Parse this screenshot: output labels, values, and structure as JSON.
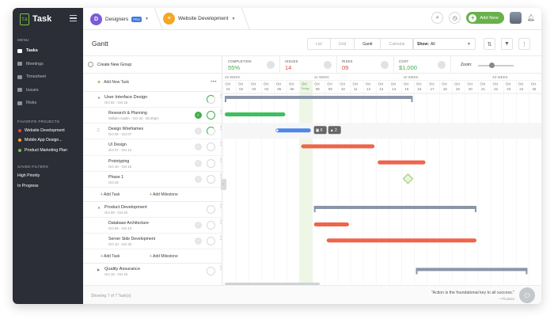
{
  "app": {
    "name": "Task"
  },
  "sidebar": {
    "menu_heading": "MENU",
    "menu": [
      {
        "label": "Tasks",
        "active": true
      },
      {
        "label": "Meetings",
        "active": false
      },
      {
        "label": "Timesheet",
        "active": false
      },
      {
        "label": "Issues",
        "active": false
      },
      {
        "label": "Risks",
        "active": false
      }
    ],
    "favorites_heading": "FAVORITE PROJECTS",
    "favorites": [
      {
        "label": "Website Development",
        "color": "#e8453c"
      },
      {
        "label": "Mobile App Design...",
        "color": "#f5a623"
      },
      {
        "label": "Product Marketing Plan",
        "color": "#7bc043"
      }
    ],
    "filters_heading": "SAVED FILTERS",
    "filters": [
      "High Priority",
      "In Progress"
    ]
  },
  "topbar": {
    "workspace_initial": "D",
    "workspace_name": "Designers",
    "workspace_badge": "PRO",
    "project_name": "Website Development",
    "add_new_label": "Add New"
  },
  "titlebar": {
    "title": "Gantt",
    "views": [
      "List",
      "Grid",
      "Gantt",
      "Calendar"
    ],
    "active_view": "Gantt",
    "show_label": "Show:",
    "show_value": "All"
  },
  "stats": {
    "completion": {
      "label": "COMPLETION",
      "value": "55%",
      "color": "#3fae49"
    },
    "issues": {
      "label": "ISSUES",
      "value": "14",
      "color": "#e8453c"
    },
    "risks": {
      "label": "RISKS",
      "value": "09",
      "color": "#e8453c"
    },
    "cost": {
      "label": "COST",
      "value": "$1,000",
      "color": "#3fae49"
    },
    "zoom_label": "Zoom:",
    "zoom_level": 0.35
  },
  "tasklist": {
    "create_group": "Create New Group",
    "add_new_task": "Add New Task",
    "add_task": "Add Task",
    "add_milestone": "Add Milestone",
    "groups": [
      {
        "name": "User Interface Design",
        "dates": "Oct 02 - Oct 15",
        "tasks": [
          {
            "name": "Research & Planning",
            "dates": "William Austin - Oct 02 - 05:20pm",
            "done": true
          },
          {
            "name": "Design Wireframes",
            "dates": "Oct 05 - Oct 07",
            "done": false
          },
          {
            "name": "UI Design",
            "dates": "Oct 07 - Oct 12",
            "done": false
          },
          {
            "name": "Prototyping",
            "dates": "Oct 10 - Oct 15",
            "done": false
          },
          {
            "name": "Phase 1",
            "dates": "Oct 15",
            "done": false
          }
        ]
      },
      {
        "name": "Product Development",
        "dates": "Oct 09 - Oct 20",
        "tasks": [
          {
            "name": "Database Architecture",
            "dates": "Oct 09 - Oct 10",
            "done": false
          },
          {
            "name": "Server Side Development",
            "dates": "Oct 10 - Oct 20",
            "done": false
          }
        ]
      },
      {
        "name": "Quality Assurance",
        "dates": "Oct 16 - Oct 25",
        "tasks": []
      }
    ]
  },
  "gantt": {
    "weeks": [
      "40 WEEK",
      "41 WEEK",
      "42 WEEK",
      "43 WEEK"
    ],
    "days": [
      "01",
      "02",
      "03",
      "04",
      "05",
      "06",
      "07",
      "08",
      "09",
      "10",
      "11",
      "12",
      "13",
      "14",
      "15",
      "16",
      "17",
      "18",
      "19",
      "20",
      "21",
      "22",
      "23",
      "24",
      "25"
    ],
    "month": "Oct",
    "today_label": "Today",
    "today_day": "07",
    "badge_comments": "6",
    "badge_alerts": "2",
    "bars": [
      {
        "row": 0,
        "start": "01",
        "end": "15",
        "kind": "summary",
        "color": "#8a96a8"
      },
      {
        "row": 1,
        "start": "01",
        "end": "05",
        "kind": "task",
        "color": "#3fbf5f"
      },
      {
        "row": 2,
        "start": "05",
        "end": "07",
        "kind": "task",
        "color": "#4d86e8"
      },
      {
        "row": 3,
        "start": "07",
        "end": "12",
        "kind": "task",
        "color": "#f06449"
      },
      {
        "row": 4,
        "start": "13",
        "end": "16",
        "kind": "task",
        "color": "#f06449"
      },
      {
        "row": 5,
        "start": "15",
        "end": "15",
        "kind": "milestone",
        "color": "#7bc043"
      },
      {
        "row": 6,
        "start": "08",
        "end": "20",
        "kind": "summary",
        "color": "#8a96a8"
      },
      {
        "row": 7,
        "start": "08",
        "end": "10",
        "kind": "task",
        "color": "#f06449"
      },
      {
        "row": 8,
        "start": "09",
        "end": "20",
        "kind": "task",
        "color": "#f06449"
      },
      {
        "row": 9,
        "start": "16",
        "end": "24",
        "kind": "summary",
        "color": "#8a96a8"
      }
    ]
  },
  "footer": {
    "showing": "Showing 7 of 7 Task(s)",
    "quote": "\"Action is the foundational key to all success.\"",
    "author": "~ Picasso"
  }
}
